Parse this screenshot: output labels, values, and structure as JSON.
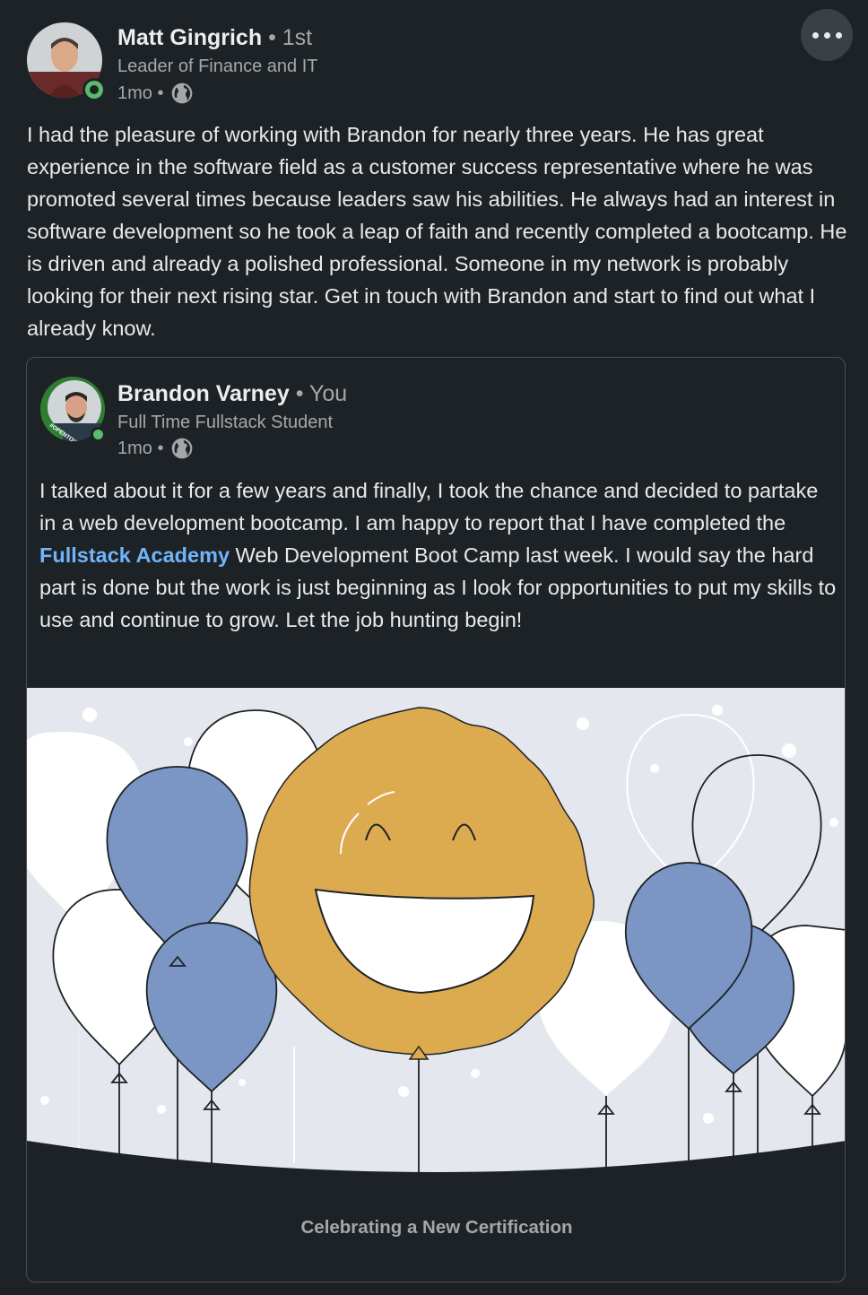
{
  "post": {
    "author": {
      "name": "Matt Gingrich",
      "degree": "• 1st",
      "headline": "Leader of Finance and IT",
      "time": "1mo •",
      "visibility_icon": "globe-icon"
    },
    "more_icon": "more-horizontal-icon",
    "text": "I had the pleasure of working with Brandon for nearly three years. He has great experience in the software field as a customer success representative where he was promoted several times because leaders saw his abilities. He always had an interest in software development so he took a leap of faith and recently completed a bootcamp. He is driven and already a polished professional. Someone in my network is probably looking for their next rising star. Get in touch with Brandon and start to find out what I already know."
  },
  "reshared": {
    "author": {
      "name": "Brandon Varney",
      "degree": "• You",
      "headline": "Full Time Fullstack Student",
      "time": "1mo •",
      "visibility_icon": "globe-icon",
      "frame_badge": "#OPENTOWORK"
    },
    "text_before": "I talked about it for a few years and finally, I took the chance and decided to partake in a web development bootcamp. I am happy to report that I have completed the ",
    "link_text": "Fullstack Academy",
    "text_after": " Web Development Boot Camp last week. I would say the hard part is done but the work is just beginning as I look for opportunities to put my skills to use and continue to grow. Let the job hunting begin!",
    "caption": "Celebrating a New Certification"
  },
  "colors": {
    "background": "#1d2226",
    "link": "#70b5f9",
    "online": "#5aba6e",
    "balloon_blue": "#7b96c5",
    "sun_gold": "#dcaa4f",
    "illustration_bg": "#e4e8ee"
  }
}
